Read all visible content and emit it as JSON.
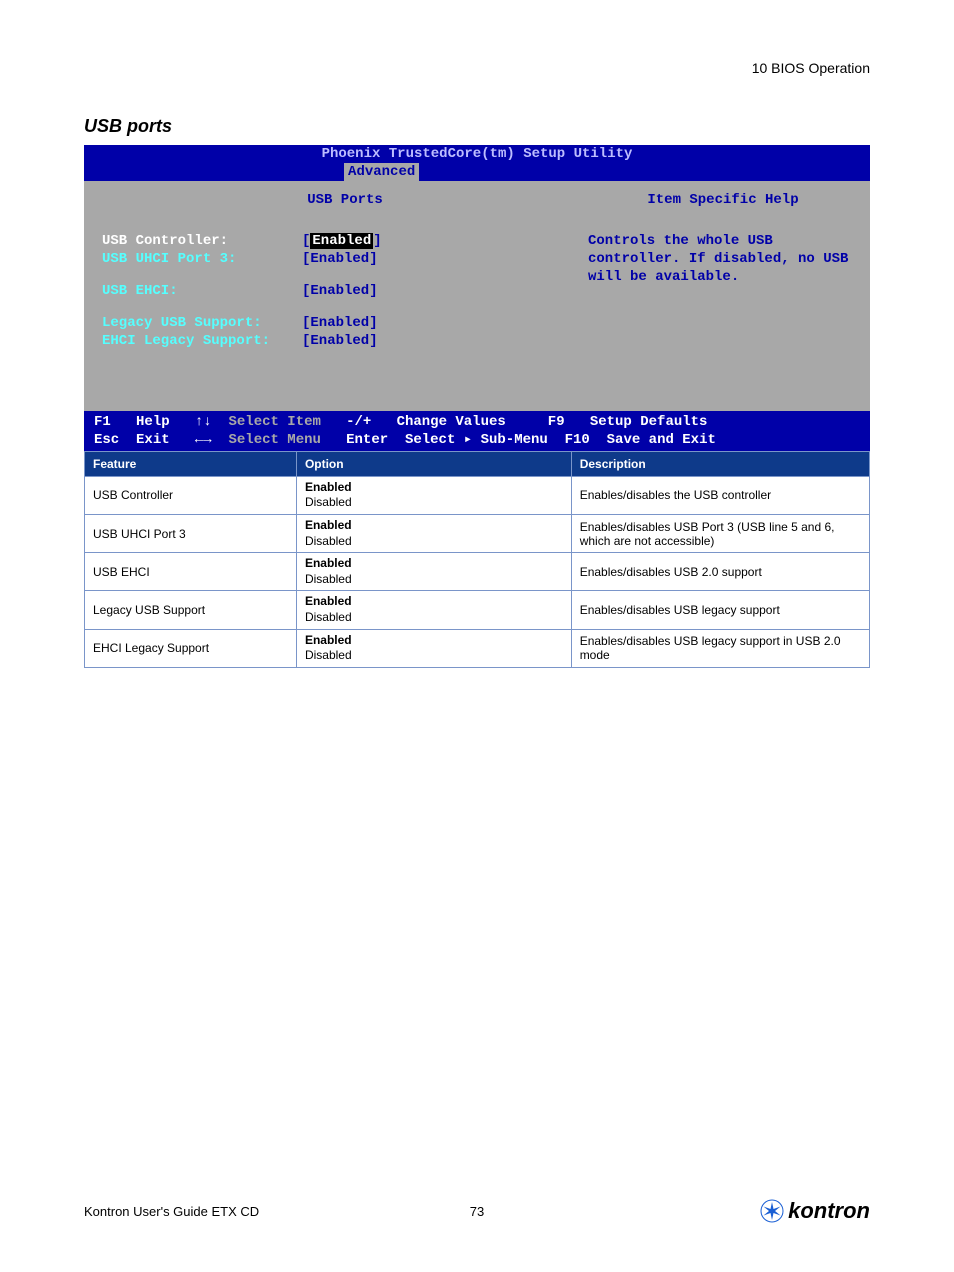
{
  "header": {
    "chapter": "10 BIOS Operation"
  },
  "section": {
    "title": "USB ports"
  },
  "bios": {
    "title": "Phoenix TrustedCore(tm) Setup Utility",
    "menu_active": "Advanced",
    "subtitle": "USB Ports",
    "help_title": "Item Specific Help",
    "help_body": "Controls the whole USB controller. If disabled, no USB will be available.",
    "items": {
      "r0_label": "USB Controller:",
      "r0_value": "[Enabled]",
      "r1_label": "USB UHCI Port 3:",
      "r1_value": "[Enabled]",
      "r2_label": "USB EHCI:",
      "r2_value": "[Enabled]",
      "r3_label": "Legacy USB Support:",
      "r3_value": "[Enabled]",
      "r4_label": "EHCI Legacy Support:",
      "r4_value": "[Enabled]"
    },
    "footer": {
      "l1_k1": "F1",
      "l1_t1": "Help",
      "l1_k2": "↑↓",
      "l1_t2": "Select Item",
      "l1_k3": "-/+",
      "l1_t3": "Change Values",
      "l1_k4": "F9",
      "l1_t4": "Setup Defaults",
      "l2_k1": "Esc",
      "l2_t1": "Exit",
      "l2_k2": "←→",
      "l2_t2": "Select Menu",
      "l2_k3": "Enter",
      "l2_t3": "Select ▸ Sub-Menu",
      "l2_k4": "F10",
      "l2_t4": "Save and Exit"
    }
  },
  "table": {
    "headers": {
      "feature": "Feature",
      "option": "Option",
      "desc": "Description"
    },
    "rows": [
      {
        "feature": "USB Controller",
        "opt1": "Enabled",
        "opt2": "Disabled",
        "desc": "Enables/disables the USB controller"
      },
      {
        "feature": "USB UHCI Port 3",
        "opt1": "Enabled",
        "opt2": "Disabled",
        "desc": "Enables/disables USB Port 3 (USB line 5 and 6, which are not accessible)"
      },
      {
        "feature": "USB EHCI",
        "opt1": "Enabled",
        "opt2": "Disabled",
        "desc": "Enables/disables USB 2.0 support"
      },
      {
        "feature": "Legacy USB Support",
        "opt1": "Enabled",
        "opt2": "Disabled",
        "desc": "Enables/disables USB legacy support"
      },
      {
        "feature": "EHCI Legacy Support",
        "opt1": "Enabled",
        "opt2": "Disabled",
        "desc": "Enables/disables USB legacy support in USB 2.0 mode"
      }
    ]
  },
  "footer": {
    "left": "Kontron User's Guide ETX CD",
    "page": "73",
    "brand": "kontron"
  }
}
